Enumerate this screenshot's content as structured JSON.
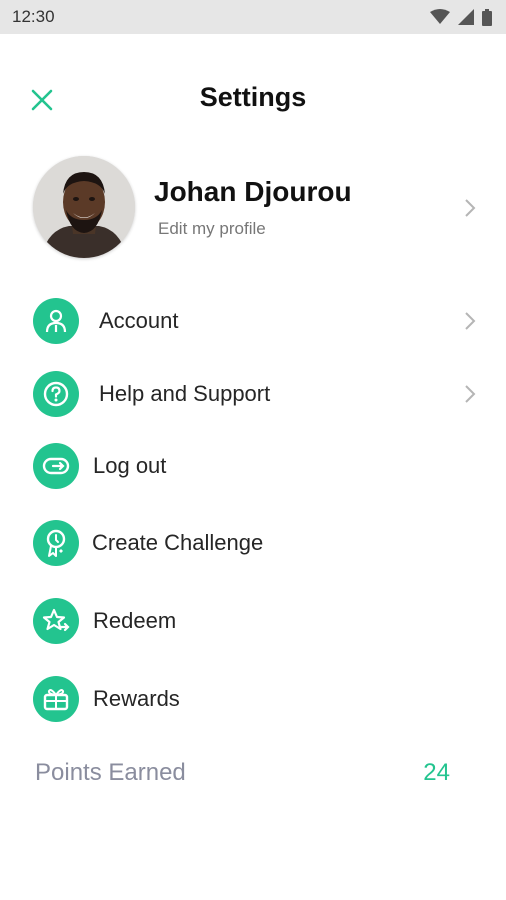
{
  "status_bar": {
    "time": "12:30"
  },
  "header": {
    "title": "Settings"
  },
  "profile": {
    "name": "Johan Djourou",
    "subtitle": "Edit my profile"
  },
  "menu": {
    "items": [
      {
        "label": "Account",
        "icon": "account-icon",
        "has_chevron": true
      },
      {
        "label": "Help and Support",
        "icon": "help-icon",
        "has_chevron": true
      },
      {
        "label": "Log out",
        "icon": "logout-icon",
        "has_chevron": false
      },
      {
        "label": "Create Challenge",
        "icon": "challenge-icon",
        "has_chevron": false
      },
      {
        "label": "Redeem",
        "icon": "redeem-icon",
        "has_chevron": false
      },
      {
        "label": "Rewards",
        "icon": "rewards-icon",
        "has_chevron": false
      }
    ]
  },
  "points": {
    "label": "Points Earned",
    "value": "24"
  },
  "colors": {
    "accent": "#23c48f",
    "muted_text": "#8a8d9e",
    "status_bar": "#e6e6e6"
  }
}
